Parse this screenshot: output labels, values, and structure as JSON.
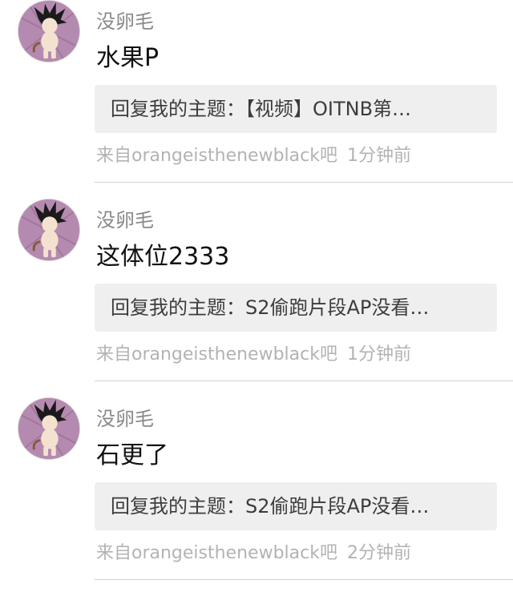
{
  "feed": {
    "items": [
      {
        "username": "没卵毛",
        "content": "水果P",
        "quote": "回复我的主题：【视频】OITNB第…",
        "source": "来自orangeisthenewblack吧",
        "time": "1分钟前"
      },
      {
        "username": "没卵毛",
        "content": "这体位2333",
        "quote": "回复我的主题：S2偷跑片段AP没看…",
        "source": "来自orangeisthenewblack吧",
        "time": "1分钟前"
      },
      {
        "username": "没卵毛",
        "content": "石更了",
        "quote": "回复我的主题：S2偷跑片段AP没看…",
        "source": "来自orangeisthenewblack吧",
        "time": "2分钟前"
      }
    ]
  },
  "colors": {
    "username": "#8a8a8a",
    "content": "#111111",
    "quote_bg": "#efefef",
    "meta": "#b3b3b3",
    "divider": "#d2d2d2",
    "avatar_bg": "#b58ab0"
  },
  "icons": {
    "avatar": "cartoon-boy-avatar"
  }
}
